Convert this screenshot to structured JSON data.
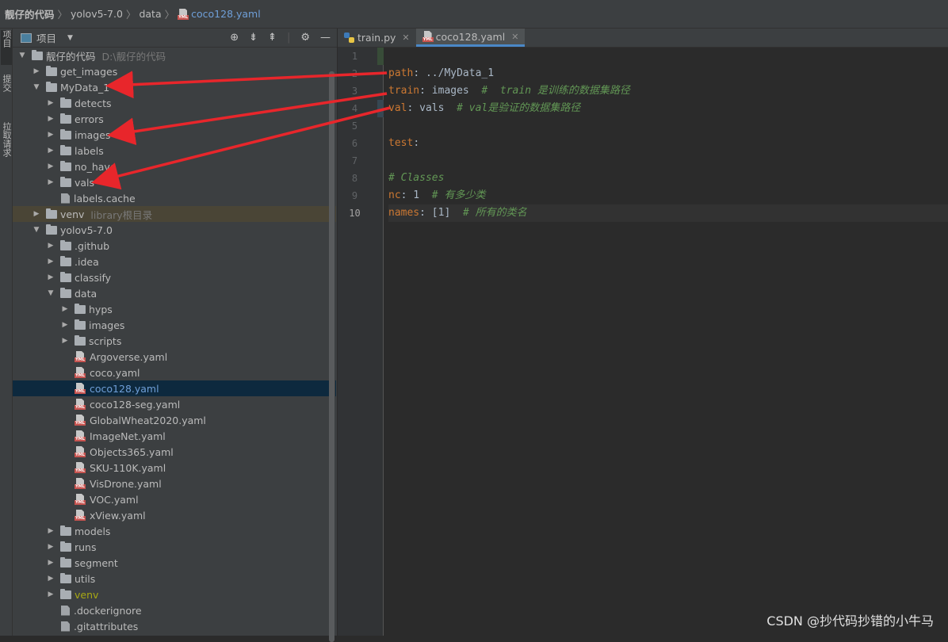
{
  "breadcrumb": [
    "靓仔的代码",
    "yolov5-7.0",
    "data",
    "coco128.yaml"
  ],
  "side_tools": [
    "项目",
    "提交",
    "拉取请求"
  ],
  "project_panel": {
    "title": "项目"
  },
  "tree": [
    {
      "depth": 0,
      "arrow": "down",
      "type": "folder",
      "label": "靓仔的代码",
      "hint": "D:\\靓仔的代码"
    },
    {
      "depth": 1,
      "arrow": "right",
      "type": "folder",
      "label": "get_images"
    },
    {
      "depth": 1,
      "arrow": "down",
      "type": "folder",
      "label": "MyData_1"
    },
    {
      "depth": 2,
      "arrow": "right",
      "type": "folder",
      "label": "detects"
    },
    {
      "depth": 2,
      "arrow": "right",
      "type": "folder",
      "label": "errors"
    },
    {
      "depth": 2,
      "arrow": "right",
      "type": "folder",
      "label": "images"
    },
    {
      "depth": 2,
      "arrow": "right",
      "type": "folder",
      "label": "labels"
    },
    {
      "depth": 2,
      "arrow": "right",
      "type": "folder",
      "label": "no_have"
    },
    {
      "depth": 2,
      "arrow": "right",
      "type": "folder",
      "label": "vals"
    },
    {
      "depth": 2,
      "arrow": "none",
      "type": "file",
      "label": "labels.cache"
    },
    {
      "depth": 1,
      "arrow": "right",
      "type": "folder",
      "label": "venv",
      "hint": "library根目录",
      "venvrow": true
    },
    {
      "depth": 1,
      "arrow": "down",
      "type": "folder",
      "label": "yolov5-7.0"
    },
    {
      "depth": 2,
      "arrow": "right",
      "type": "folder",
      "label": ".github"
    },
    {
      "depth": 2,
      "arrow": "right",
      "type": "folder",
      "label": ".idea"
    },
    {
      "depth": 2,
      "arrow": "right",
      "type": "folder",
      "label": "classify"
    },
    {
      "depth": 2,
      "arrow": "down",
      "type": "folder",
      "label": "data"
    },
    {
      "depth": 3,
      "arrow": "right",
      "type": "folder",
      "label": "hyps"
    },
    {
      "depth": 3,
      "arrow": "right",
      "type": "folder",
      "label": "images"
    },
    {
      "depth": 3,
      "arrow": "right",
      "type": "folder",
      "label": "scripts"
    },
    {
      "depth": 3,
      "arrow": "none",
      "type": "yaml",
      "label": "Argoverse.yaml"
    },
    {
      "depth": 3,
      "arrow": "none",
      "type": "yaml",
      "label": "coco.yaml"
    },
    {
      "depth": 3,
      "arrow": "none",
      "type": "yaml",
      "label": "coco128.yaml",
      "selected": true
    },
    {
      "depth": 3,
      "arrow": "none",
      "type": "yaml",
      "label": "coco128-seg.yaml"
    },
    {
      "depth": 3,
      "arrow": "none",
      "type": "yaml",
      "label": "GlobalWheat2020.yaml"
    },
    {
      "depth": 3,
      "arrow": "none",
      "type": "yaml",
      "label": "ImageNet.yaml"
    },
    {
      "depth": 3,
      "arrow": "none",
      "type": "yaml",
      "label": "Objects365.yaml"
    },
    {
      "depth": 3,
      "arrow": "none",
      "type": "yaml",
      "label": "SKU-110K.yaml"
    },
    {
      "depth": 3,
      "arrow": "none",
      "type": "yaml",
      "label": "VisDrone.yaml"
    },
    {
      "depth": 3,
      "arrow": "none",
      "type": "yaml",
      "label": "VOC.yaml"
    },
    {
      "depth": 3,
      "arrow": "none",
      "type": "yaml",
      "label": "xView.yaml"
    },
    {
      "depth": 2,
      "arrow": "right",
      "type": "folder",
      "label": "models"
    },
    {
      "depth": 2,
      "arrow": "right",
      "type": "folder",
      "label": "runs"
    },
    {
      "depth": 2,
      "arrow": "right",
      "type": "folder",
      "label": "segment"
    },
    {
      "depth": 2,
      "arrow": "right",
      "type": "folder",
      "label": "utils"
    },
    {
      "depth": 2,
      "arrow": "right",
      "type": "folder",
      "label": "venv",
      "venv": true
    },
    {
      "depth": 2,
      "arrow": "none",
      "type": "file",
      "label": ".dockerignore"
    },
    {
      "depth": 2,
      "arrow": "none",
      "type": "file",
      "label": ".gitattributes"
    }
  ],
  "tabs": [
    {
      "label": "train.py",
      "icon": "python-icon",
      "active": false
    },
    {
      "label": "coco128.yaml",
      "icon": "yaml-icon",
      "active": true
    }
  ],
  "editor": {
    "current_line": 10,
    "lines": [
      [],
      [
        {
          "t": "path",
          "c": "key"
        },
        {
          "t": ": ../MyData_1",
          "c": "val"
        }
      ],
      [
        {
          "t": "train",
          "c": "key"
        },
        {
          "t": ": images  ",
          "c": "val"
        },
        {
          "t": "#  train 是训练的数据集路径",
          "c": "cmt"
        }
      ],
      [
        {
          "t": "val",
          "c": "key"
        },
        {
          "t": ": vals  ",
          "c": "val"
        },
        {
          "t": "# val是验证的数据集路径",
          "c": "cmt"
        }
      ],
      [],
      [
        {
          "t": "test",
          "c": "key"
        },
        {
          "t": ":",
          "c": "val"
        }
      ],
      [],
      [
        {
          "t": "# Classes",
          "c": "cmt"
        }
      ],
      [
        {
          "t": "nc",
          "c": "key"
        },
        {
          "t": ": 1  ",
          "c": "val"
        },
        {
          "t": "# 有多少类",
          "c": "cmt"
        }
      ],
      [
        {
          "t": "names",
          "c": "key"
        },
        {
          "t": ": [1]  ",
          "c": "val"
        },
        {
          "t": "# 所有的类名",
          "c": "cmt"
        }
      ]
    ]
  },
  "watermark": "CSDN @抄代码抄错的小牛马",
  "colors": {
    "arrow": "#e8262b",
    "keyword": "#cc7832",
    "comment": "#629755",
    "selection": "#0d293e"
  }
}
